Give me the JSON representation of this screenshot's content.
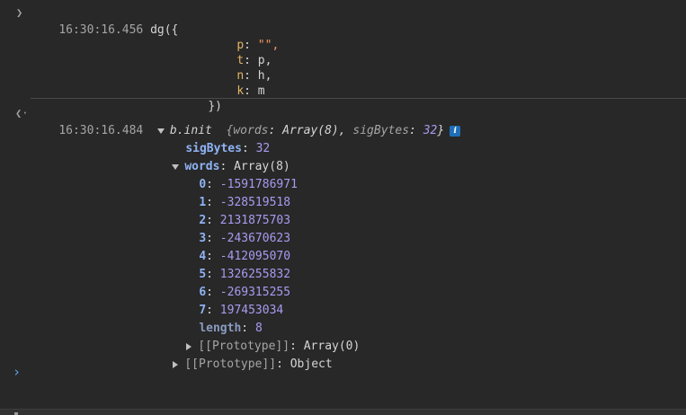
{
  "entry1": {
    "timestamp": "16:30:16.456",
    "call": "dg({",
    "args": [
      {
        "key": "p",
        "sep": ": ",
        "value": "\"\","
      },
      {
        "key": "t",
        "sep": ": ",
        "value": "p,"
      },
      {
        "key": "n",
        "sep": ": ",
        "value": "h,"
      },
      {
        "key": "k",
        "sep": ": ",
        "value": "m"
      }
    ],
    "close": "})"
  },
  "entry2": {
    "timestamp": "16:30:16.484",
    "name": "b.init",
    "preview_open": "{",
    "preview_k1": "words",
    "preview_v1": ": Array(8), ",
    "preview_k2": "sigBytes",
    "preview_sep2": ": ",
    "preview_v2": "32",
    "preview_close": "}",
    "info_badge": "i",
    "sigBytes_key": "sigBytes",
    "sigBytes_value": "32",
    "words_key": "words",
    "words_type": "Array(8)",
    "words": [
      {
        "index": "0",
        "value": "-1591786971"
      },
      {
        "index": "1",
        "value": "-328519518"
      },
      {
        "index": "2",
        "value": "2131875703"
      },
      {
        "index": "3",
        "value": "-243670623"
      },
      {
        "index": "4",
        "value": "-412095070"
      },
      {
        "index": "5",
        "value": "1326255832"
      },
      {
        "index": "6",
        "value": "-269315255"
      },
      {
        "index": "7",
        "value": "197453034"
      }
    ],
    "length_key": "length",
    "length_value": "8",
    "words_proto": "[[Prototype]]",
    "words_proto_value": "Array(0)",
    "obj_proto": "[[Prototype]]",
    "obj_proto_value": "Object"
  },
  "prompt_symbol": "›",
  "icons": {
    "expand_input": "chevron-right-icon",
    "result_return": "return-arrow-icon"
  }
}
